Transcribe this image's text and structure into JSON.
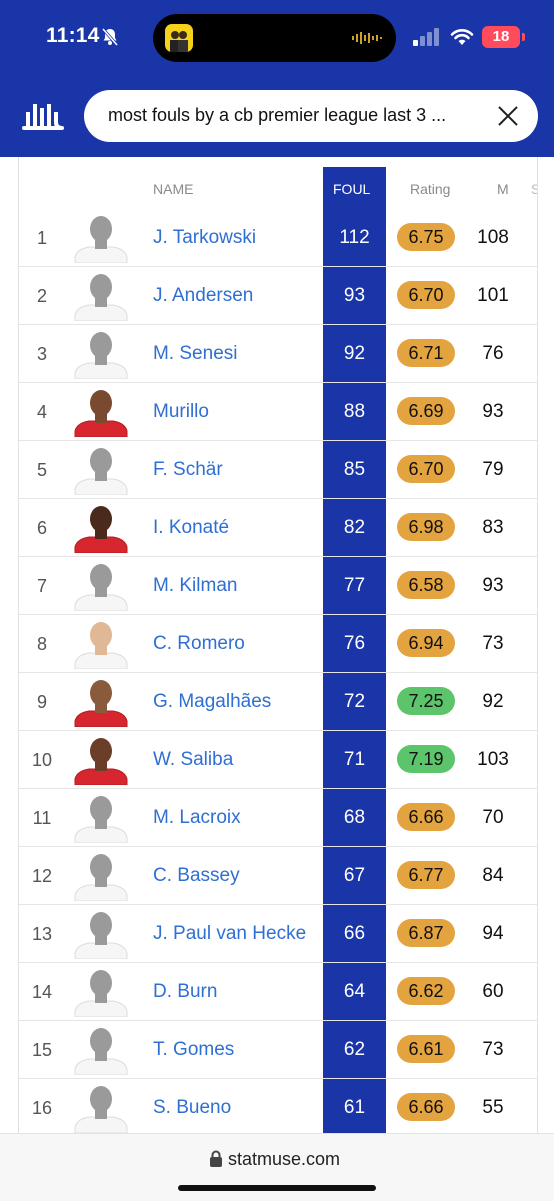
{
  "status": {
    "time": "11:14",
    "battery": "18"
  },
  "search": {
    "query": "most fouls by a cb premier league last 3 ..."
  },
  "table": {
    "headers": {
      "name": "NAME",
      "foul": "FOUL",
      "rating": "Rating",
      "m": "M",
      "extra": "S"
    },
    "rows": [
      {
        "rank": "1",
        "name": "J. Tarkowski",
        "foul": "112",
        "rating": "6.75",
        "m": "108",
        "kit": "white",
        "skin": "#9a9a9a",
        "rating_color": "#e3a33f"
      },
      {
        "rank": "2",
        "name": "J. Andersen",
        "foul": "93",
        "rating": "6.70",
        "m": "101",
        "kit": "white",
        "skin": "#9a9a9a",
        "rating_color": "#e3a33f"
      },
      {
        "rank": "3",
        "name": "M. Senesi",
        "foul": "92",
        "rating": "6.71",
        "m": "76",
        "kit": "white",
        "skin": "#9a9a9a",
        "rating_color": "#e3a33f"
      },
      {
        "rank": "4",
        "name": "Murillo",
        "foul": "88",
        "rating": "6.69",
        "m": "93",
        "kit": "red",
        "skin": "#7a4a30",
        "rating_color": "#e3a33f"
      },
      {
        "rank": "5",
        "name": "F. Schär",
        "foul": "85",
        "rating": "6.70",
        "m": "79",
        "kit": "white",
        "skin": "#9a9a9a",
        "rating_color": "#e3a33f"
      },
      {
        "rank": "6",
        "name": "I. Konaté",
        "foul": "82",
        "rating": "6.98",
        "m": "83",
        "kit": "red",
        "skin": "#4a2a1a",
        "rating_color": "#e3a33f"
      },
      {
        "rank": "7",
        "name": "M. Kilman",
        "foul": "77",
        "rating": "6.58",
        "m": "93",
        "kit": "white",
        "skin": "#9a9a9a",
        "rating_color": "#e3a33f"
      },
      {
        "rank": "8",
        "name": "C. Romero",
        "foul": "76",
        "rating": "6.94",
        "m": "73",
        "kit": "white-real",
        "skin": "#e0b896",
        "rating_color": "#e3a33f"
      },
      {
        "rank": "9",
        "name": "G. Magalhães",
        "foul": "72",
        "rating": "7.25",
        "m": "92",
        "kit": "red",
        "skin": "#8a5a3c",
        "rating_color": "#5cc46a"
      },
      {
        "rank": "10",
        "name": "W. Saliba",
        "foul": "71",
        "rating": "7.19",
        "m": "103",
        "kit": "red",
        "skin": "#6a3e28",
        "rating_color": "#5cc46a"
      },
      {
        "rank": "11",
        "name": "M. Lacroix",
        "foul": "68",
        "rating": "6.66",
        "m": "70",
        "kit": "white",
        "skin": "#9a9a9a",
        "rating_color": "#e3a33f"
      },
      {
        "rank": "12",
        "name": "C. Bassey",
        "foul": "67",
        "rating": "6.77",
        "m": "84",
        "kit": "white",
        "skin": "#9a9a9a",
        "rating_color": "#e3a33f"
      },
      {
        "rank": "13",
        "name": "J. Paul van Hecke",
        "foul": "66",
        "rating": "6.87",
        "m": "94",
        "kit": "white",
        "skin": "#9a9a9a",
        "rating_color": "#e3a33f"
      },
      {
        "rank": "14",
        "name": "D. Burn",
        "foul": "64",
        "rating": "6.62",
        "m": "60",
        "kit": "white",
        "skin": "#9a9a9a",
        "rating_color": "#e3a33f"
      },
      {
        "rank": "15",
        "name": "T. Gomes",
        "foul": "62",
        "rating": "6.61",
        "m": "73",
        "kit": "white",
        "skin": "#9a9a9a",
        "rating_color": "#e3a33f"
      },
      {
        "rank": "16",
        "name": "S. Bueno",
        "foul": "61",
        "rating": "6.66",
        "m": "55",
        "kit": "white",
        "skin": "#9a9a9a",
        "rating_color": "#e3a33f"
      }
    ]
  },
  "browser": {
    "url": "statmuse.com"
  },
  "colors": {
    "brand": "#1a35a8",
    "link": "#2f6fd3",
    "rating_mid": "#e3a33f",
    "rating_good": "#5cc46a"
  }
}
